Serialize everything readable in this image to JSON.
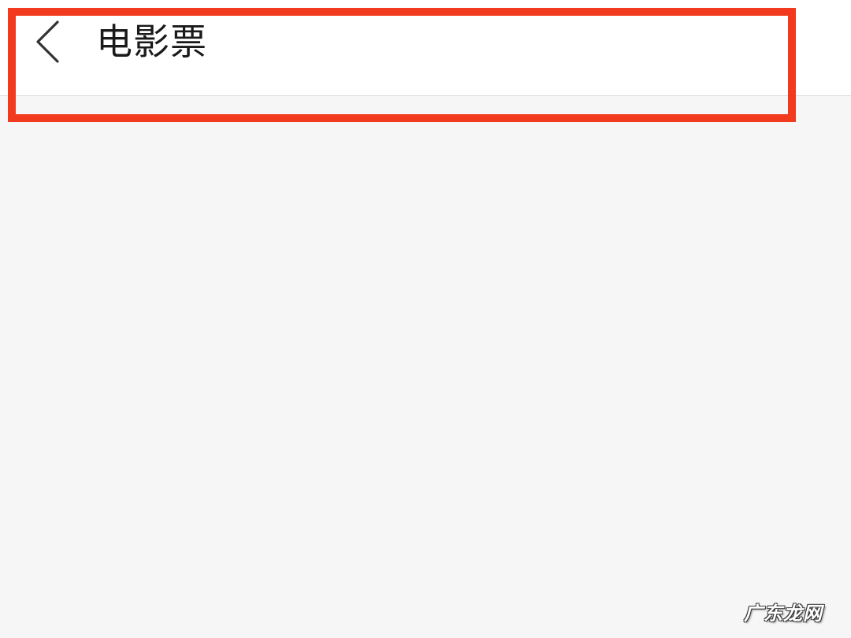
{
  "header": {
    "back_icon": "chevron-left-icon",
    "title": "电影票"
  },
  "annotation": {
    "highlight_color": "#f23b1e"
  },
  "watermark": {
    "text": "广东龙网"
  },
  "colors": {
    "background": "#f7f6f6",
    "nav_background": "#ffffff",
    "text": "#1a1a1a"
  }
}
